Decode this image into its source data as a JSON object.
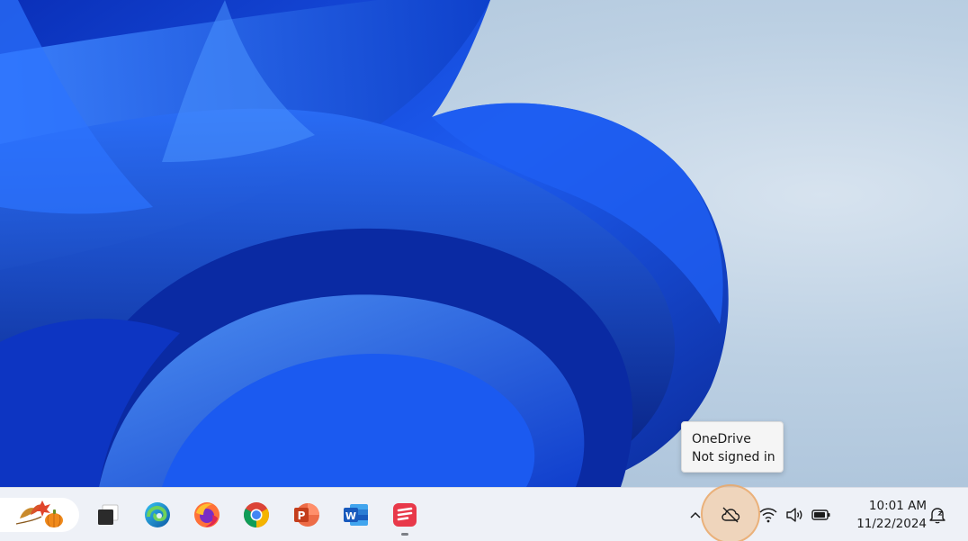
{
  "tooltip": {
    "title": "OneDrive",
    "status": "Not signed in"
  },
  "taskbar": {
    "apps": [
      {
        "name": "Task View",
        "icon": "task-view-icon"
      },
      {
        "name": "Microsoft Edge",
        "icon": "edge-icon"
      },
      {
        "name": "Firefox",
        "icon": "firefox-icon"
      },
      {
        "name": "Google Chrome",
        "icon": "chrome-icon"
      },
      {
        "name": "PowerPoint",
        "icon": "powerpoint-icon",
        "letter": "P"
      },
      {
        "name": "Word",
        "icon": "word-icon",
        "letter": "W"
      },
      {
        "name": "Pinned app",
        "icon": "red-app-icon"
      }
    ],
    "tray": {
      "overflow_icon": "chevron-up-icon",
      "onedrive_icon": "cloud-off-icon",
      "wifi_icon": "wifi-icon",
      "volume_icon": "volume-icon",
      "battery_icon": "battery-icon",
      "notification_icon": "notification-bell-icon"
    },
    "clock": {
      "time": "10:01 AM",
      "date": "11/22/2024"
    }
  },
  "colors": {
    "wallpaper_blue": "#1a55e6",
    "taskbar_bg": "#eef1f7",
    "highlight": "#f1bd8c"
  }
}
